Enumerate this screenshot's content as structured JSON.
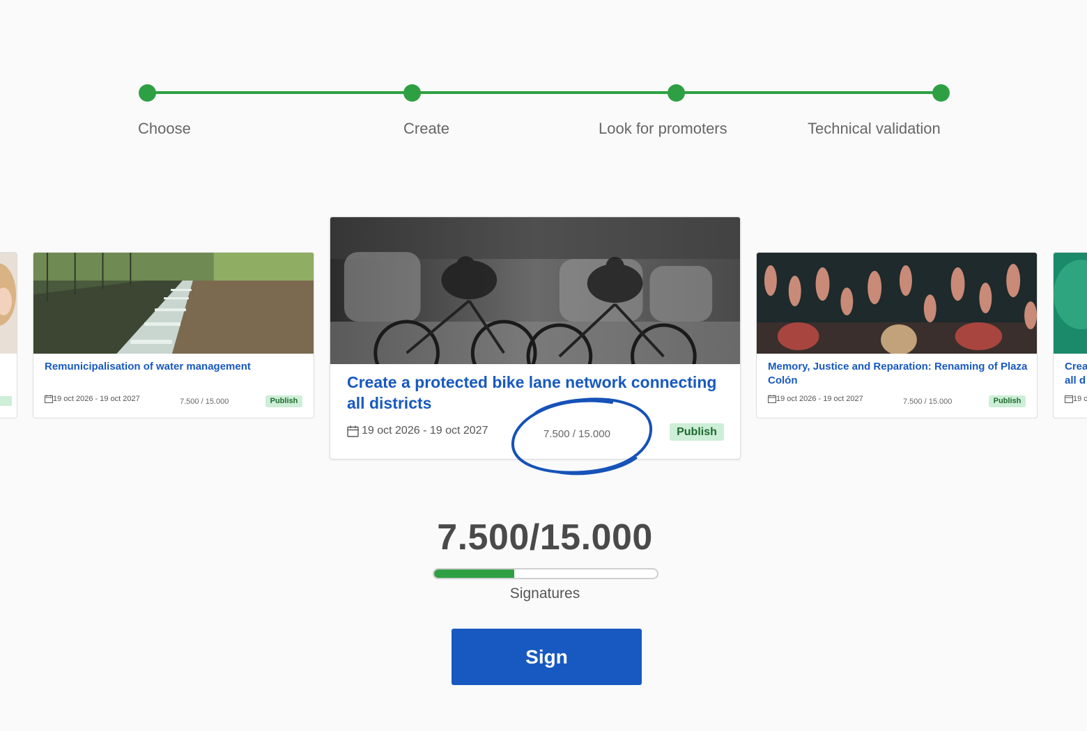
{
  "stepper": {
    "steps": [
      {
        "label": "Choose"
      },
      {
        "label": "Create"
      },
      {
        "label": "Look for promoters"
      },
      {
        "label": "Technical validation"
      }
    ],
    "color": "#2ea043"
  },
  "cards": {
    "left_edge": {
      "badge": ""
    },
    "water": {
      "title": "Remunicipalisation of water management",
      "date": "19 oct 2026 - 19 oct 2027",
      "count": "7.500 / 15.000",
      "badge": "Publish"
    },
    "featured": {
      "title": "Create a protected bike lane network connecting all districts",
      "date": "19 oct 2026 - 19 oct 2027",
      "count": "7.500 / 15.000",
      "badge": "Publish"
    },
    "memory": {
      "title": "Memory, Justice and Reparation: Renaming of Plaza Colón",
      "date": "19 oct 2026 - 19 oct 2027",
      "count": "7.500 / 15.000",
      "badge": "Publish"
    },
    "right_edge": {
      "title": "Crea all d",
      "date": "19 c"
    }
  },
  "signatures": {
    "count": "7.500/15.000",
    "progress_fraction": 0.5,
    "label": "Signatures",
    "button_label": "Sign"
  },
  "colors": {
    "accent_blue": "#1759c0",
    "accent_green": "#2ea043",
    "badge_bg": "#cdeed7"
  }
}
